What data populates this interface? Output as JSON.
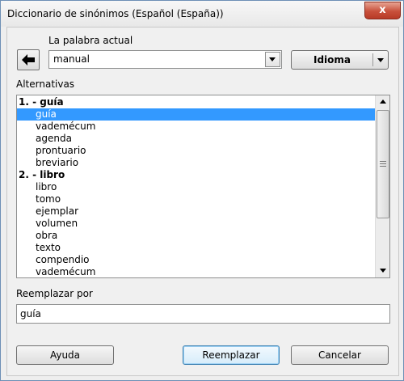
{
  "window": {
    "title": "Diccionario de sinónimos (Español (España))",
    "close_glyph": "x"
  },
  "labels": {
    "current_word": "La palabra actual",
    "alternatives": "Alternativas",
    "replace_with": "Reemplazar por"
  },
  "current_word": {
    "value": "manual"
  },
  "language_button": {
    "label": "Idioma"
  },
  "alternatives": [
    {
      "text": "1. - guía",
      "kind": "head"
    },
    {
      "text": "guía",
      "kind": "item",
      "selected": true
    },
    {
      "text": "vademécum",
      "kind": "item"
    },
    {
      "text": "agenda",
      "kind": "item"
    },
    {
      "text": "prontuario",
      "kind": "item"
    },
    {
      "text": "breviario",
      "kind": "item"
    },
    {
      "text": "2. - libro",
      "kind": "head"
    },
    {
      "text": "libro",
      "kind": "item"
    },
    {
      "text": "tomo",
      "kind": "item"
    },
    {
      "text": "ejemplar",
      "kind": "item"
    },
    {
      "text": "volumen",
      "kind": "item"
    },
    {
      "text": "obra",
      "kind": "item"
    },
    {
      "text": "texto",
      "kind": "item"
    },
    {
      "text": "compendio",
      "kind": "item"
    },
    {
      "text": "vademécum",
      "kind": "item"
    }
  ],
  "replace": {
    "value": "guía"
  },
  "buttons": {
    "help": "Ayuda",
    "replace": "Reemplazar",
    "cancel": "Cancelar"
  },
  "colors": {
    "selection": "#3399ff",
    "close": "#c8503b"
  },
  "icons": {
    "back": "arrow-left-icon",
    "close": "close-icon"
  }
}
